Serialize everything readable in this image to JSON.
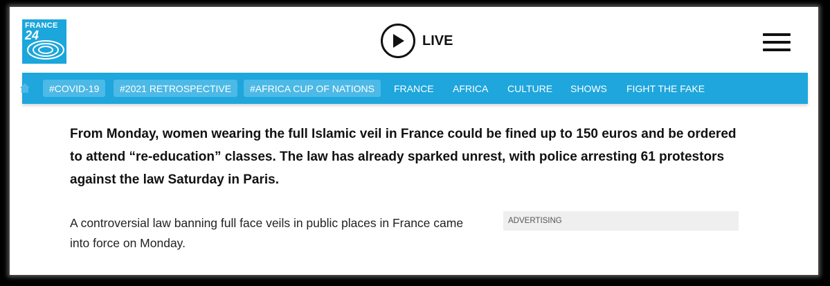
{
  "header": {
    "logo": {
      "line1": "FRANCE",
      "line2": "24",
      "color": "#1ba6dc"
    },
    "live_label": "LIVE",
    "menu_icon": "hamburger-menu-icon"
  },
  "nav": {
    "background": "#1ea6dd",
    "home_icon": "home-icon",
    "tags": [
      "#COVID-19",
      "#2021 RETROSPECTIVE",
      "#AFRICA CUP OF NATIONS"
    ],
    "links": [
      "FRANCE",
      "AFRICA",
      "CULTURE",
      "SHOWS",
      "FIGHT THE FAKE"
    ]
  },
  "article": {
    "lead": "From Monday, women wearing the full Islamic veil in France could be fined up to 150 euros and be ordered to attend “re-education” classes. The law has already sparked unrest, with police arresting 61 protestors against the law Saturday in Paris.",
    "body": "A controversial law banning full face veils in public places in France came into force on Monday.",
    "ad_label": "ADVERTISING"
  }
}
